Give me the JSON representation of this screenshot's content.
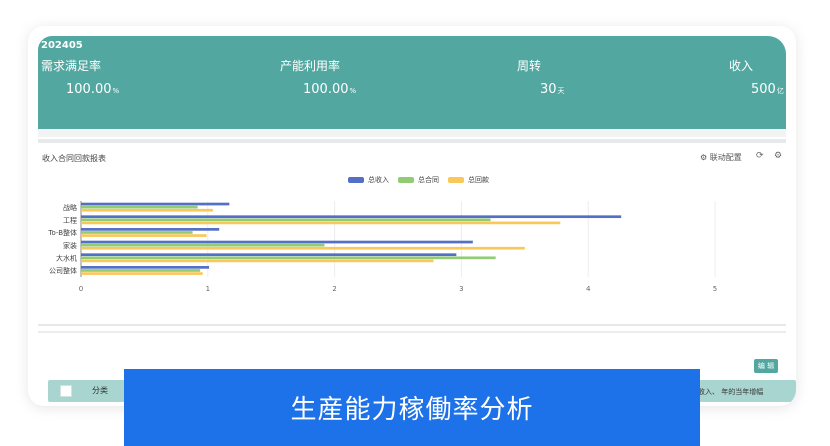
{
  "header": {
    "period": "202405",
    "metrics": [
      {
        "label": "需求满足率",
        "value": "100.00",
        "unit": "%"
      },
      {
        "label": "产能利用率",
        "value": "100.00",
        "unit": "%"
      },
      {
        "label": "周转",
        "value": "30",
        "unit": "天"
      },
      {
        "label": "收入",
        "value": "500",
        "unit": "亿"
      }
    ],
    "color": "#52a8a1"
  },
  "report": {
    "title": "收入合同回款报表",
    "config_label": "⚙ 联动配置",
    "refresh_icon": "refresh-icon",
    "settings_icon": "settings-icon"
  },
  "chart_data": {
    "type": "bar",
    "orientation": "horizontal",
    "categories": [
      "战略",
      "工程",
      "To-B整体",
      "家装",
      "大水机",
      "公司整体"
    ],
    "series": [
      {
        "name": "总收入",
        "color": "#5470c6",
        "values": [
          1.17,
          4.26,
          1.09,
          3.09,
          2.96,
          1.01
        ]
      },
      {
        "name": "总合同",
        "color": "#91cc75",
        "values": [
          0.92,
          3.23,
          0.88,
          1.92,
          3.27,
          0.94
        ]
      },
      {
        "name": "总回款",
        "color": "#fac858",
        "values": [
          1.04,
          3.78,
          0.99,
          3.5,
          2.78,
          0.96
        ]
      }
    ],
    "x_ticks": [
      "0",
      "1",
      "2",
      "3",
      "4",
      "5"
    ],
    "xlim": [
      0,
      5
    ],
    "grid": true,
    "legend": "top-center"
  },
  "toolbar": {
    "edit_label": "编 辑"
  },
  "table": {
    "columns": [
      "分类"
    ],
    "right_partial": "收入、 年的当年增幅"
  },
  "banner": {
    "text": "生産能力稼働率分析",
    "color": "#1d72ea"
  }
}
